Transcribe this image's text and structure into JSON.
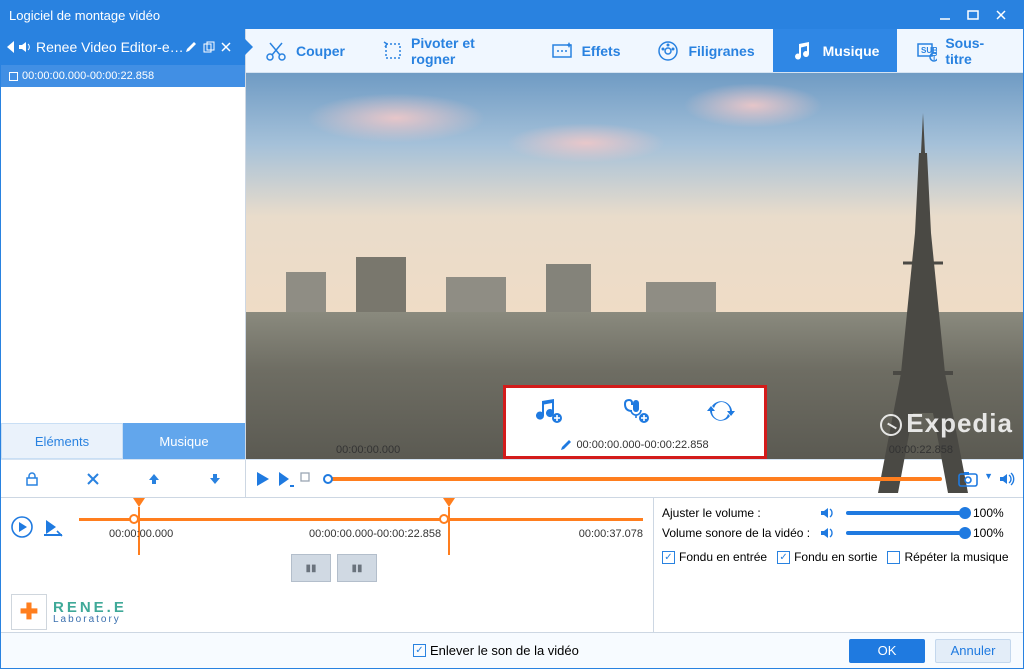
{
  "title": "Logiciel de montage vidéo",
  "clip": {
    "name": "Renee Video Editor-ex...",
    "timecode": "00:00:00.000-00:00:22.858"
  },
  "left_tabs": {
    "elements": "Eléments",
    "music": "Musique"
  },
  "toolbar": {
    "cut": "Couper",
    "rotate": "Pivoter et rogner",
    "effects": "Effets",
    "watermark": "Filigranes",
    "music": "Musique",
    "subtitle": "Sous-titre"
  },
  "overlay": {
    "timecode": "00:00:00.000-00:00:22.858"
  },
  "watermark_text": "Expedia",
  "progress": {
    "start": "00:00:00.000",
    "end": "00:00:22.858"
  },
  "timeline": {
    "labels": {
      "start": "00:00:00.000",
      "mid": "00:00:00.000-00:00:22.858",
      "end": "00:00:37.078"
    }
  },
  "volume": {
    "adjust_label": "Ajuster le volume :",
    "video_label": "Volume sonore de la vidéo :",
    "adjust_pct": "100%",
    "video_pct": "100%"
  },
  "options": {
    "fadein": "Fondu en entrée",
    "fadeout": "Fondu en sortie",
    "repeat": "Répéter la musique",
    "remove_audio": "Enlever le son de la vidéo"
  },
  "buttons": {
    "ok": "OK",
    "cancel": "Annuler"
  },
  "logo": {
    "brand": "RENE.E",
    "sub": "Laboratory"
  }
}
